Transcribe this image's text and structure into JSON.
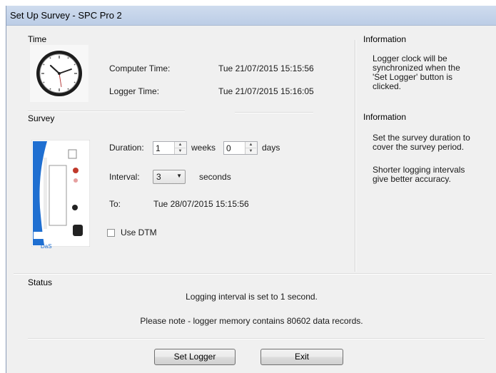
{
  "window": {
    "title": "Set Up Survey - SPC Pro 2"
  },
  "time": {
    "header": "Time",
    "computer_time_label": "Computer Time:",
    "computer_time_value": "Tue 21/07/2015 15:15:56",
    "logger_time_label": "Logger Time:",
    "logger_time_value": "Tue 21/07/2015 15:16:05"
  },
  "info_time": {
    "header": "Information",
    "text": "Logger clock will be synchronized when the 'Set Logger' button is clicked."
  },
  "survey": {
    "header": "Survey",
    "duration_label": "Duration:",
    "weeks_value": "1",
    "weeks_unit": "weeks",
    "days_value": "0",
    "days_unit": "days",
    "interval_label": "Interval:",
    "interval_value": "3",
    "interval_unit": "seconds",
    "to_label": "To:",
    "to_value": "Tue 28/07/2015 15:15:56",
    "use_dtm_label": "Use DTM",
    "use_dtm_checked": false,
    "device_brand": "DaS"
  },
  "info_survey": {
    "header": "Information",
    "text1": "Set the survey duration to cover the survey period.",
    "text2": "Shorter logging intervals give better accuracy."
  },
  "status": {
    "header": "Status",
    "line1": "Logging interval is set to 1 second.",
    "line2": "Please note - logger memory contains 80602 data records."
  },
  "buttons": {
    "set_logger": "Set Logger",
    "exit": "Exit"
  },
  "colors": {
    "titlebar": "#c4d3e9",
    "window_bg": "#f0f0f0",
    "device_accent": "#1f6fd1"
  }
}
